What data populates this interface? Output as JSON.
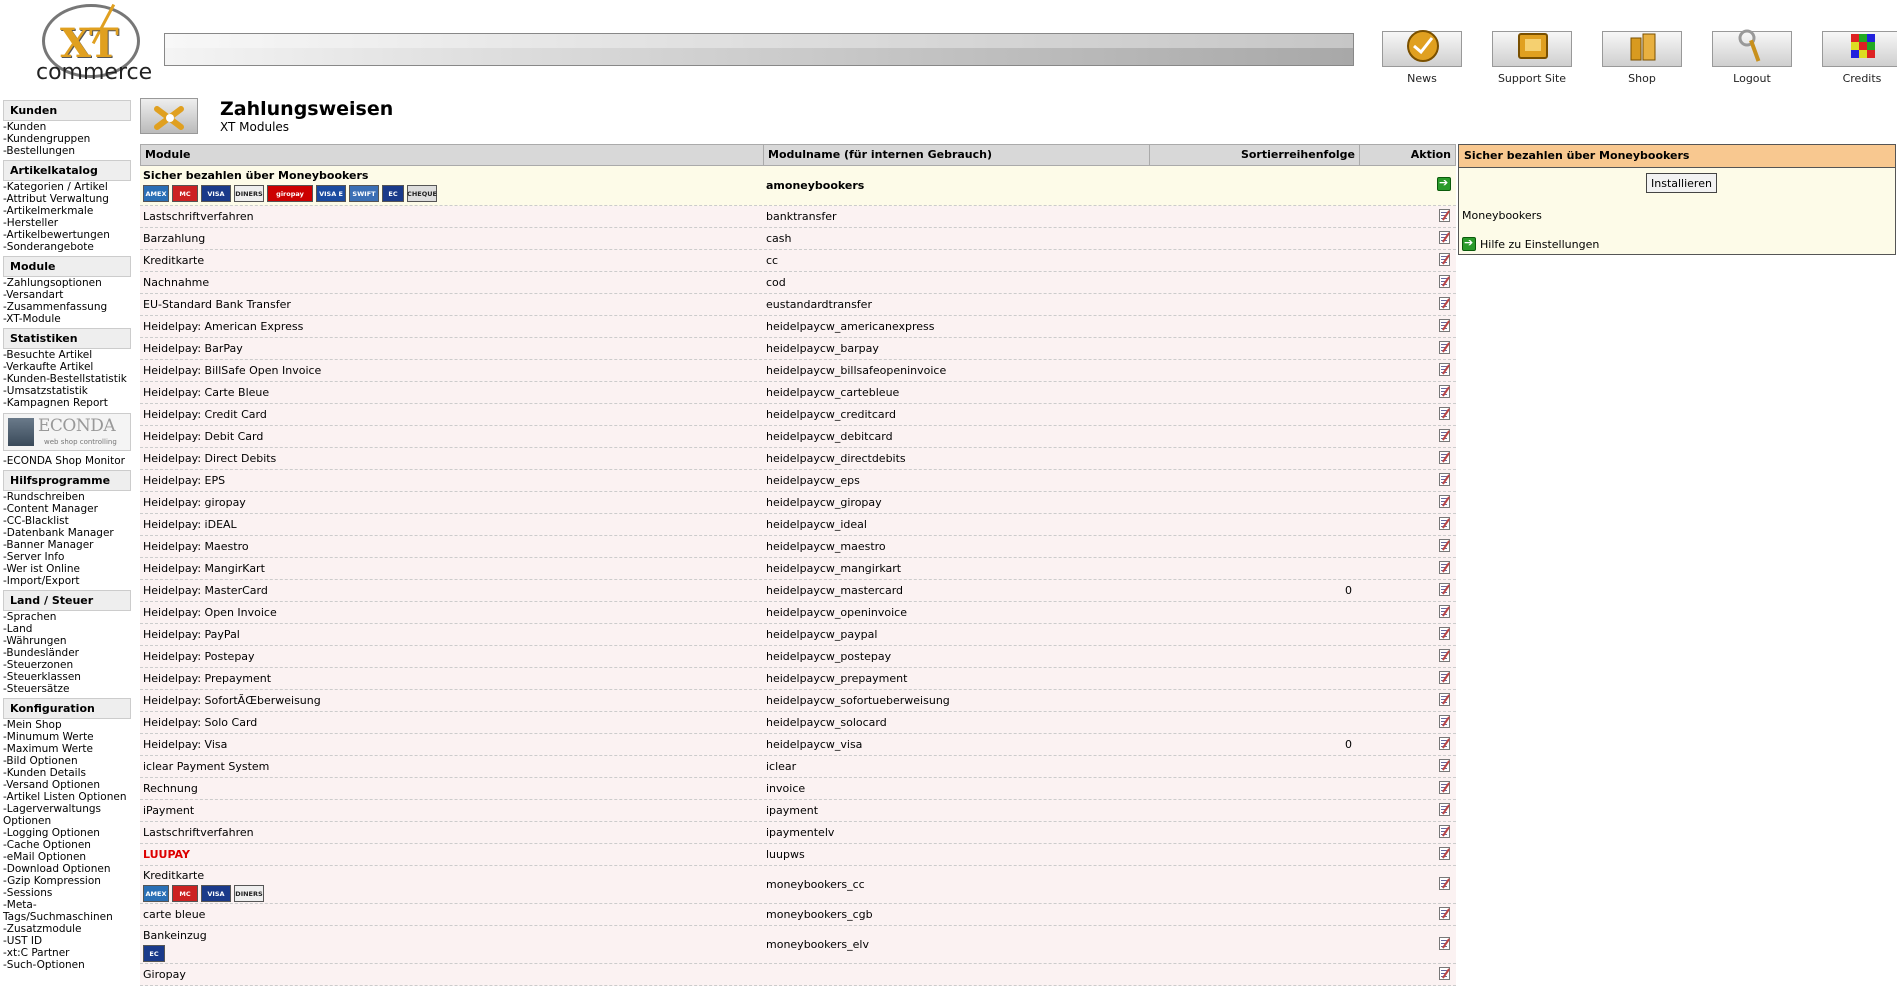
{
  "header": {
    "logo_mark": "XT",
    "logo_text": "commerce",
    "nav": [
      {
        "label": "News",
        "icon": "news-icon"
      },
      {
        "label": "Support Site",
        "icon": "support-icon"
      },
      {
        "label": "Shop",
        "icon": "shop-icon"
      },
      {
        "label": "Logout",
        "icon": "key-icon"
      },
      {
        "label": "Credits",
        "icon": "cube-icon"
      }
    ]
  },
  "sidebar": {
    "sections": [
      {
        "title": "Kunden",
        "items": [
          "-Kunden",
          "-Kundengruppen",
          "-Bestellungen"
        ]
      },
      {
        "title": "Artikelkatalog",
        "items": [
          "-Kategorien / Artikel",
          "-Attribut Verwaltung",
          "-Artikelmerkmale",
          "-Hersteller",
          "-Artikelbewertungen",
          "-Sonderangebote"
        ]
      },
      {
        "title": "Module",
        "items": [
          "-Zahlungsoptionen",
          "-Versandart",
          "-Zusammenfassung",
          "-XT-Module"
        ]
      },
      {
        "title": "Statistiken",
        "items": [
          "-Besuchte Artikel",
          "-Verkaufte Artikel",
          "-Kunden-Bestellstatistik",
          "-Umsatzstatistik",
          "-Kampagnen Report"
        ]
      },
      {
        "title": "Hilfsprogramme",
        "items": [
          "-Rundschreiben",
          "-Content Manager",
          "-CC-Blacklist",
          "-Datenbank Manager",
          "-Banner Manager",
          "-Server Info",
          "-Wer ist Online",
          "-Import/Export"
        ]
      },
      {
        "title": "Land / Steuer",
        "items": [
          "-Sprachen",
          "-Land",
          "-Währungen",
          "-Bundesländer",
          "-Steuerzonen",
          "-Steuerklassen",
          "-Steuersätze"
        ]
      },
      {
        "title": "Konfiguration",
        "items": [
          "-Mein Shop",
          "-Minumum Werte",
          "-Maximum Werte",
          "-Bild Optionen",
          "-Kunden Details",
          "-Versand Optionen",
          "-Artikel Listen Optionen",
          "-Lagerverwaltungs Optionen",
          "-Logging Optionen",
          "-Cache Optionen",
          "-eMail Optionen",
          "-Download Optionen",
          "-Gzip Kompression",
          "-Sessions",
          "-Meta-Tags/Suchmaschinen",
          "-Zusatzmodule",
          "-UST ID",
          "-xt:C Partner",
          "-Such-Optionen"
        ]
      }
    ],
    "econda": {
      "logo": "ECONDA",
      "tagline": "web shop controlling",
      "link": "-ECONDA Shop Monitor"
    }
  },
  "page": {
    "title": "Zahlungsweisen",
    "subtitle": "XT Modules"
  },
  "table": {
    "headers": {
      "module": "Module",
      "code": "Modulname (für internen Gebrauch)",
      "sort": "Sortierreihenfolge",
      "action": "Aktion"
    },
    "rows": [
      {
        "module": "Sicher bezahlen über Moneybookers",
        "code": "amoneybookers",
        "sort": "",
        "selected": true,
        "cards": [
          "AMEX",
          "MC",
          "VISA",
          "DINERS",
          "giropay",
          "VISA E",
          "SWIFT",
          "EC",
          "CHEQUE"
        ]
      },
      {
        "module": "Lastschriftverfahren",
        "code": "banktransfer",
        "sort": ""
      },
      {
        "module": "Barzahlung",
        "code": "cash",
        "sort": ""
      },
      {
        "module": "Kreditkarte",
        "code": "cc",
        "sort": ""
      },
      {
        "module": "Nachnahme",
        "code": "cod",
        "sort": ""
      },
      {
        "module": "EU-Standard Bank Transfer",
        "code": "eustandardtransfer",
        "sort": ""
      },
      {
        "module": "Heidelpay: American Express",
        "code": "heidelpaycw_americanexpress",
        "sort": ""
      },
      {
        "module": "Heidelpay: BarPay",
        "code": "heidelpaycw_barpay",
        "sort": ""
      },
      {
        "module": "Heidelpay: BillSafe Open Invoice",
        "code": "heidelpaycw_billsafeopeninvoice",
        "sort": ""
      },
      {
        "module": "Heidelpay: Carte Bleue",
        "code": "heidelpaycw_cartebleue",
        "sort": ""
      },
      {
        "module": "Heidelpay: Credit Card",
        "code": "heidelpaycw_creditcard",
        "sort": ""
      },
      {
        "module": "Heidelpay: Debit Card",
        "code": "heidelpaycw_debitcard",
        "sort": ""
      },
      {
        "module": "Heidelpay: Direct Debits",
        "code": "heidelpaycw_directdebits",
        "sort": ""
      },
      {
        "module": "Heidelpay: EPS",
        "code": "heidelpaycw_eps",
        "sort": ""
      },
      {
        "module": "Heidelpay: giropay",
        "code": "heidelpaycw_giropay",
        "sort": ""
      },
      {
        "module": "Heidelpay: iDEAL",
        "code": "heidelpaycw_ideal",
        "sort": ""
      },
      {
        "module": "Heidelpay: Maestro",
        "code": "heidelpaycw_maestro",
        "sort": ""
      },
      {
        "module": "Heidelpay: MangirKart",
        "code": "heidelpaycw_mangirkart",
        "sort": ""
      },
      {
        "module": "Heidelpay: MasterCard",
        "code": "heidelpaycw_mastercard",
        "sort": "0"
      },
      {
        "module": "Heidelpay: Open Invoice",
        "code": "heidelpaycw_openinvoice",
        "sort": ""
      },
      {
        "module": "Heidelpay: PayPal",
        "code": "heidelpaycw_paypal",
        "sort": ""
      },
      {
        "module": "Heidelpay: Postepay",
        "code": "heidelpaycw_postepay",
        "sort": ""
      },
      {
        "module": "Heidelpay: Prepayment",
        "code": "heidelpaycw_prepayment",
        "sort": ""
      },
      {
        "module": "Heidelpay: SofortÃŒberweisung",
        "code": "heidelpaycw_sofortueberweisung",
        "sort": ""
      },
      {
        "module": "Heidelpay: Solo Card",
        "code": "heidelpaycw_solocard",
        "sort": ""
      },
      {
        "module": "Heidelpay: Visa",
        "code": "heidelpaycw_visa",
        "sort": "0"
      },
      {
        "module": "iclear Payment System",
        "code": "iclear",
        "sort": ""
      },
      {
        "module": "Rechnung",
        "code": "invoice",
        "sort": ""
      },
      {
        "module": "iPayment",
        "code": "ipayment",
        "sort": ""
      },
      {
        "module": "Lastschriftverfahren",
        "code": "ipaymentelv",
        "sort": ""
      },
      {
        "module": "LUUPAY",
        "code": "luupws",
        "sort": "",
        "red": true
      },
      {
        "module": "Kreditkarte",
        "code": "moneybookers_cc",
        "sort": "",
        "cards": [
          "AMEX",
          "MC",
          "VISA",
          "DINERS"
        ]
      },
      {
        "module": "carte bleue",
        "code": "moneybookers_cgb",
        "sort": ""
      },
      {
        "module": "Bankeinzug",
        "code": "moneybookers_elv",
        "sort": "",
        "cards": [
          "EC"
        ]
      },
      {
        "module": "Giropay",
        "code": "",
        "sort": ""
      }
    ]
  },
  "infobox": {
    "title": "Sicher bezahlen über Moneybookers",
    "install_label": "Installieren",
    "name": "Moneybookers",
    "help_label": "Hilfe zu Einstellungen"
  }
}
